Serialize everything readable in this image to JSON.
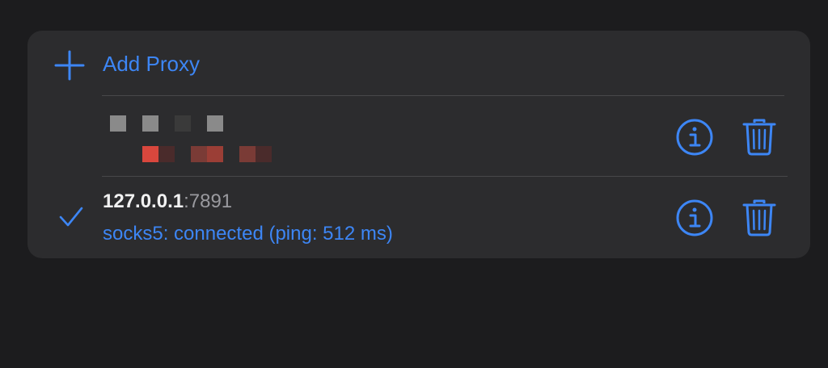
{
  "colors": {
    "background": "#1c1c1e",
    "card": "#2c2c2e",
    "accent": "#3d86f5",
    "separator": "#48484a",
    "host_text": "#f2f2f2",
    "port_text": "#9a9a9f"
  },
  "add_proxy": {
    "icon": "plus-icon",
    "label": "Add Proxy"
  },
  "proxies": [
    {
      "redacted": true,
      "info_icon": "info-icon",
      "delete_icon": "trash-icon"
    },
    {
      "selected": true,
      "selected_icon": "checkmark-icon",
      "host": "127.0.0.1",
      "port": ":7891",
      "status": "socks5: connected (ping: 512 ms)",
      "info_icon": "info-icon",
      "delete_icon": "trash-icon"
    }
  ]
}
